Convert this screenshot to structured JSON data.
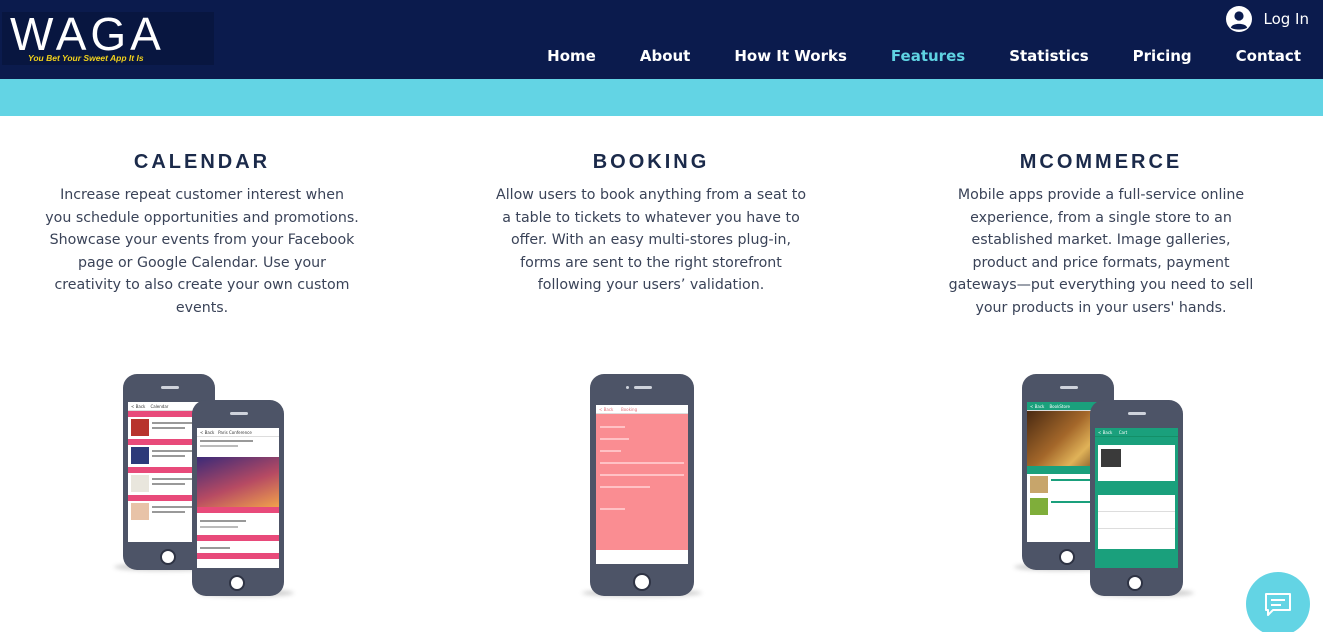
{
  "brand": {
    "name": "WAGA",
    "tagline": "You Bet Your Sweet App It Is"
  },
  "header": {
    "login_label": "Log In"
  },
  "nav": {
    "items": [
      {
        "label": "Home",
        "active": false
      },
      {
        "label": "About",
        "active": false
      },
      {
        "label": "How It Works",
        "active": false
      },
      {
        "label": "Features",
        "active": true
      },
      {
        "label": "Statistics",
        "active": false
      },
      {
        "label": "Pricing",
        "active": false
      },
      {
        "label": "Contact",
        "active": false
      }
    ]
  },
  "features": {
    "calendar": {
      "title": "CALENDAR",
      "description": "Increase repeat customer interest when you schedule opportunities and promotions. Showcase your events from your Facebook page or Google Calendar. Use your creativity to also create your own custom events."
    },
    "booking": {
      "title": "BOOKING",
      "description": "Allow users to book anything from a seat to a table to tickets to whatever you have to offer. With an easy multi-stores plug-in, forms are sent to the right storefront following your users’ validation."
    },
    "mcommerce": {
      "title": "MCOMMERCE",
      "description": "Mobile apps provide a full-service online experience, from a single store to an established market. Image galleries, product and price formats, payment gateways—put everything you need to sell your products in your users' hands."
    }
  },
  "mockups": {
    "calendar": {
      "back_screen": {
        "back": "< Back",
        "title": "Calendar"
      },
      "front_screen": {
        "back": "< Back",
        "title": "Paris Conference"
      }
    },
    "booking": {
      "back": "< Back",
      "title": "Booking"
    },
    "mcommerce": {
      "back_screen": {
        "back": "< Back",
        "title": "BookStore"
      },
      "front_screen": {
        "back": "< Back",
        "title": "Cart"
      }
    }
  },
  "colors": {
    "header_bg": "#0b1b4d",
    "stripe": "#63d4e4",
    "nav_active": "#5fd3e2",
    "calendar_accent": "#e84a7a",
    "booking_accent": "#fa8d92",
    "commerce_accent": "#1aa07c"
  },
  "icons": {
    "login": "user-circle-icon",
    "chat": "chat-bubble-icon"
  }
}
